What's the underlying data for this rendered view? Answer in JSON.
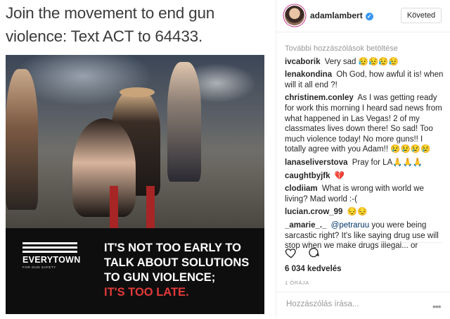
{
  "headline": "Join the movement to end gun violence: Text ACT to 64433.",
  "image": {
    "logo_name": "EVERYTOWN",
    "logo_sub": "FOR GUN SAFETY",
    "slogan_white": "IT'S NOT TOO EARLY TO TALK ABOUT SOLUTIONS TO GUN VIOLENCE;",
    "slogan_red": "IT'S TOO LATE."
  },
  "post_header": {
    "username": "adamlambert",
    "verified_icon": "verified-badge-icon",
    "follow_label": "Követed"
  },
  "comments_section": {
    "load_more": "További hozzászólások betöltése",
    "items": [
      {
        "user": "ivcaborik",
        "text": "Very sad 😥😥😥😥"
      },
      {
        "user": "lenakondina",
        "text": "Oh God, how awful it is! when will it all end ?!"
      },
      {
        "user": "christinem.conley",
        "text": "As I was getting ready for work this morning I heard sad news from what happened in Las Vegas! 2 of my classmates lives down there! So sad! Too much violence today! No more guns!! I totally agree with you Adam!! 😢😢😢😢"
      },
      {
        "user": "lanaseliverstova",
        "text": "Pray for LA🙏🙏🙏"
      },
      {
        "user": "caughtbyjfk",
        "text": "💔"
      },
      {
        "user": "clodiiam",
        "text": "What is wrong with world we living? Mad world :-("
      },
      {
        "user": "lucian.crow_99",
        "text": "😔😔"
      },
      {
        "user": "_amarie_._",
        "mention": "@petraruu",
        "text": "you were being sarcastic right? It's like saying drug use will stop when we make drugs illegal... or"
      }
    ]
  },
  "actions": {
    "like_icon": "heart-icon",
    "comment_icon": "comment-icon"
  },
  "likes": "6 034 kedvelés",
  "time_ago": "1 ÓRÁJA",
  "add_comment_placeholder": "Hozzászólás írása...",
  "more_options": "•••"
}
